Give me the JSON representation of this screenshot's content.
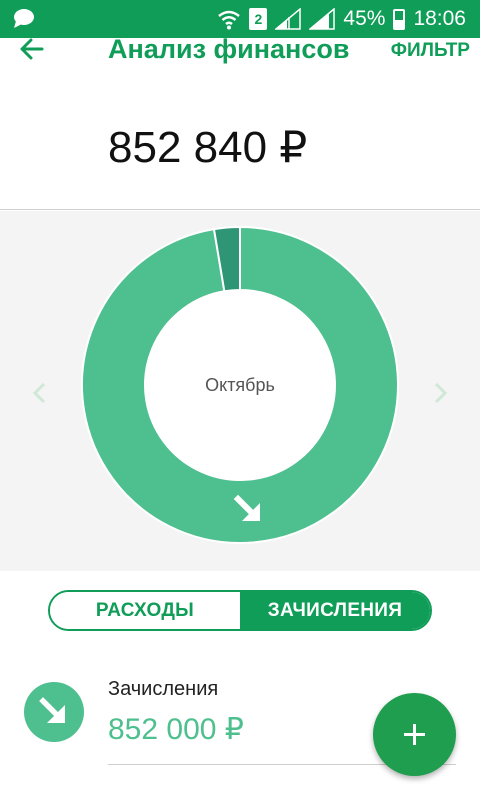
{
  "status_bar": {
    "battery_percent": "45%",
    "battery_level": 0.45,
    "sim_slot": "2",
    "time": "18:06"
  },
  "header": {
    "title": "Анализ финансов",
    "filter_label": "ФИЛЬТР",
    "total_amount": "852 840 ₽"
  },
  "chart": {
    "month_label": "Октябрь"
  },
  "chart_data": {
    "type": "pie",
    "categories": [
      "",
      ""
    ],
    "values": [
      852000,
      840
    ]
  },
  "toggle": {
    "expenses_label": "РАСХОДЫ",
    "income_label": "ЗАЧИСЛЕНИЯ",
    "selected": "income"
  },
  "list": {
    "items": [
      {
        "title": "Зачисления",
        "amount": "852 000 ₽"
      }
    ]
  },
  "colors": {
    "primary": "#0f9d58",
    "chart_main": "#4ebf8e",
    "chart_secondary": "#2e9675"
  },
  "icons": {
    "back": "arrow-left-icon",
    "prev": "chevron-left-icon",
    "next": "chevron-right-icon",
    "income": "arrow-down-right-icon",
    "fab": "plus-icon"
  }
}
